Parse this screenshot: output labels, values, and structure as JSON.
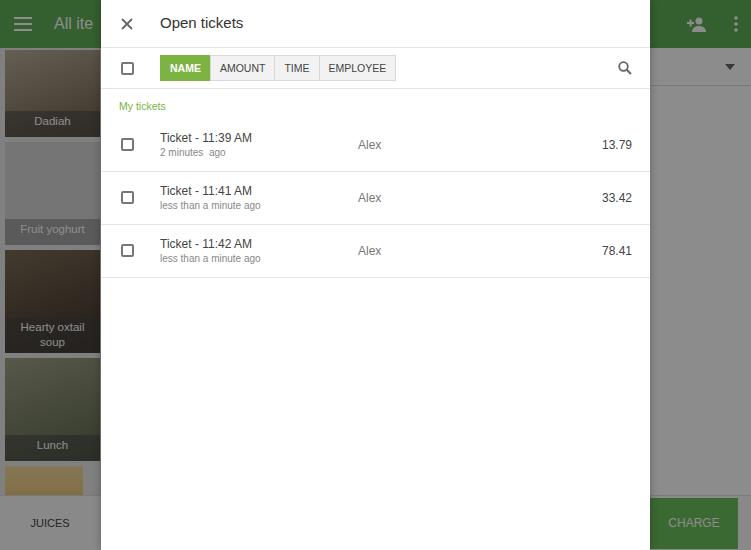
{
  "app_bar": {
    "title": "All ite"
  },
  "items": [
    {
      "name": "Dadiah",
      "kind": "photo"
    },
    {
      "name": "Fruit yoghurt",
      "kind": "plain"
    },
    {
      "name": "Hearty oxtail soup",
      "kind": "photo"
    },
    {
      "name": "Lunch",
      "kind": "photo"
    },
    {
      "kind": "photo"
    }
  ],
  "bottom_bar": {
    "category": "JUICES"
  },
  "charge_button": {
    "label": "CHARGE"
  },
  "modal": {
    "title": "Open tickets",
    "select_all": {
      "checked": false
    },
    "sort_tabs": [
      {
        "label": "NAME",
        "selected": true
      },
      {
        "label": "AMOUNT",
        "selected": false
      },
      {
        "label": "TIME",
        "selected": false
      },
      {
        "label": "EMPLOYEE",
        "selected": false
      }
    ],
    "section": "My tickets",
    "tickets": [
      {
        "title": "Ticket - 11:39 AM",
        "age": "2 minutes  ago",
        "employee": "Alex",
        "amount": "13.79",
        "checked": false
      },
      {
        "title": "Ticket - 11:41 AM",
        "age": "less than a minute ago",
        "employee": "Alex",
        "amount": "33.42",
        "checked": false
      },
      {
        "title": "Ticket - 11:42 AM",
        "age": "less than a minute ago",
        "employee": "Alex",
        "amount": "78.41",
        "checked": false
      }
    ]
  }
}
